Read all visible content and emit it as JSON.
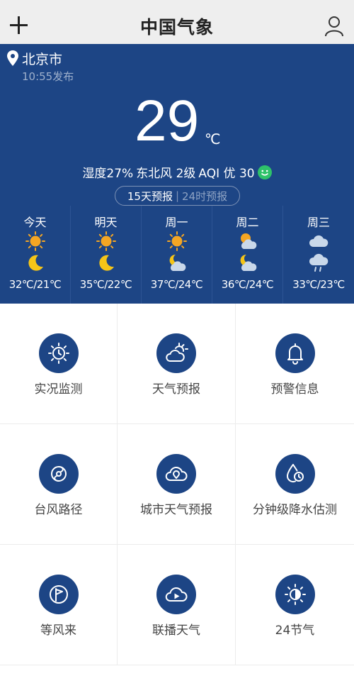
{
  "header": {
    "logo": "中国气象"
  },
  "location": {
    "city": "北京市",
    "published": "10:55发布"
  },
  "current": {
    "temp": "29",
    "unit": "℃",
    "humidity": "湿度27%",
    "wind": "东北风 2级",
    "aqi": "AQI 优 30"
  },
  "forecast_tabs": {
    "active": "15天预报",
    "inactive": "24时预报"
  },
  "forecast": [
    {
      "day": "今天",
      "day_icon": "sun-icon",
      "night_icon": "moon-icon",
      "range": "32℃/21℃"
    },
    {
      "day": "明天",
      "day_icon": "sun-icon",
      "night_icon": "moon-icon",
      "range": "35℃/22℃"
    },
    {
      "day": "周一",
      "day_icon": "sun-icon",
      "night_icon": "moon-cloud-icon",
      "range": "37℃/24℃"
    },
    {
      "day": "周二",
      "day_icon": "sun-cloud-icon",
      "night_icon": "moon-cloud-icon",
      "range": "36℃/24℃"
    },
    {
      "day": "周三",
      "day_icon": "cloud-icon",
      "night_icon": "rain-cloud-icon",
      "range": "33℃/23℃"
    }
  ],
  "menu": [
    {
      "label": "实况监测",
      "icon": "sun-clock-icon"
    },
    {
      "label": "天气预报",
      "icon": "sun-cloud-icon"
    },
    {
      "label": "预警信息",
      "icon": "bell-icon"
    },
    {
      "label": "台风路径",
      "icon": "typhoon-icon"
    },
    {
      "label": "城市天气预报",
      "icon": "cloud-location-icon"
    },
    {
      "label": "分钟级降水估测",
      "icon": "raindrop-clock-icon"
    },
    {
      "label": "等风来",
      "icon": "wind-flag-icon"
    },
    {
      "label": "联播天气",
      "icon": "cloud-play-icon"
    },
    {
      "label": "24节气",
      "icon": "half-sun-icon"
    }
  ],
  "colors": {
    "panel": "#1d4585",
    "accent_green": "#2ec26a",
    "sun": "#f5a623"
  }
}
